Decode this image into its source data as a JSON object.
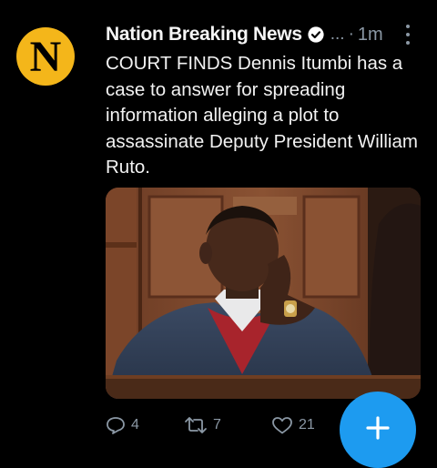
{
  "tweet": {
    "avatar_letter": "N",
    "author": "Nation Breaking News",
    "ellipsis": "...",
    "dot": "·",
    "time": "1m",
    "text": "COURT FINDS Dennis Itumbi has a case to answer for spreading information alleging a plot to assassinate Deputy President William Ruto."
  },
  "actions": {
    "replies": "4",
    "retweets": "7",
    "likes": "21"
  },
  "colors": {
    "background": "#000000",
    "avatar_bg": "#f4b61a",
    "verified": "#ffffff",
    "muted": "#8b98a5",
    "fab": "#1d9bf0"
  },
  "icons": {
    "verified": "verified-badge-icon",
    "more": "more-vertical-icon",
    "reply": "reply-icon",
    "retweet": "retweet-icon",
    "like": "heart-icon",
    "compose": "plus-icon"
  }
}
